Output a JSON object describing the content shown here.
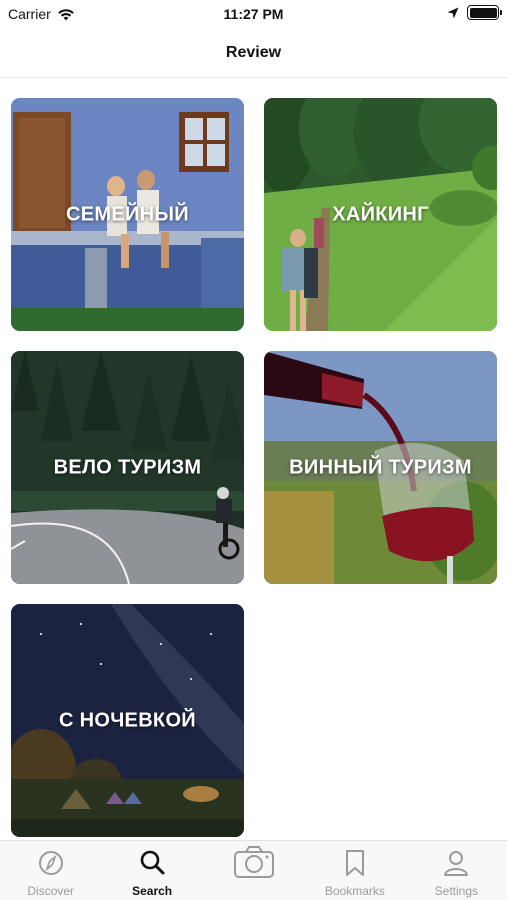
{
  "status_bar": {
    "carrier": "Carrier",
    "time": "11:27 PM",
    "battery_level": 1.0
  },
  "nav": {
    "title": "Review"
  },
  "categories": [
    {
      "label": "СЕМЕЙНЫЙ"
    },
    {
      "label": "ХАЙКИНГ"
    },
    {
      "label": "ВЕЛО ТУРИЗМ"
    },
    {
      "label": "ВИННЫЙ ТУРИЗМ"
    },
    {
      "label": "С НОЧЕВКОЙ"
    }
  ],
  "tabs": [
    {
      "label": "Discover",
      "icon": "compass-icon",
      "active": false
    },
    {
      "label": "Search",
      "icon": "search-icon",
      "active": true
    },
    {
      "label": "",
      "icon": "camera-icon",
      "active": false
    },
    {
      "label": "Bookmarks",
      "icon": "bookmark-icon",
      "active": false
    },
    {
      "label": "Settings",
      "icon": "user-icon",
      "active": false
    }
  ],
  "colors": {
    "active_tab": "#111111",
    "inactive_tab": "#9a9a9a",
    "tab_bar_bg": "#f8f8f8"
  }
}
